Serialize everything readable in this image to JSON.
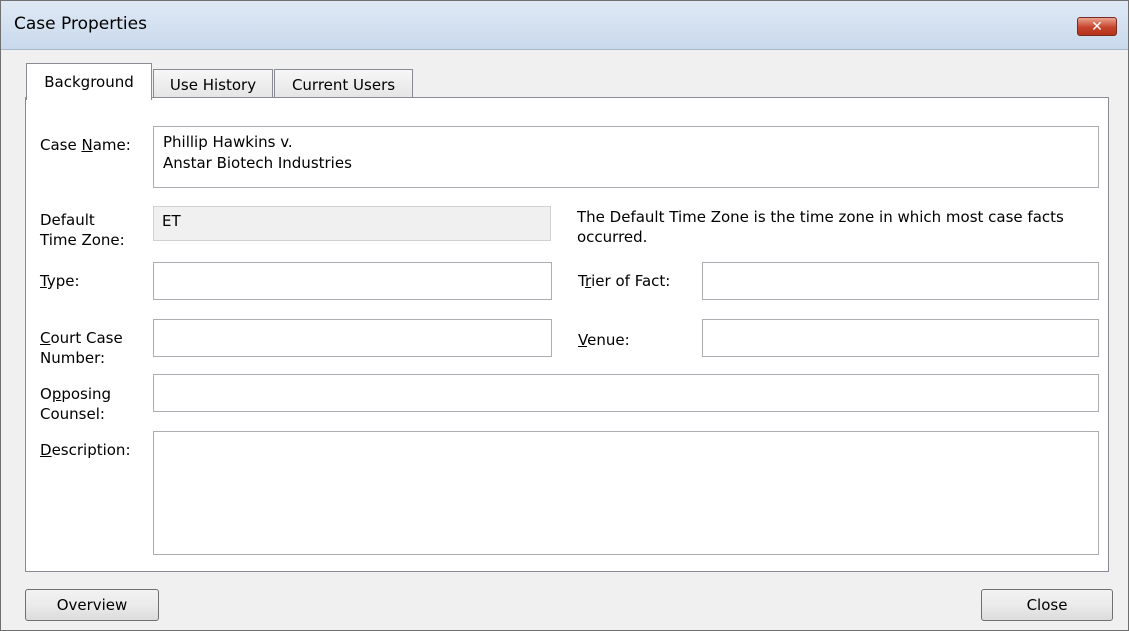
{
  "window": {
    "title": "Case Properties",
    "close_glyph": "✕"
  },
  "tabs": [
    "Background",
    "Use History",
    "Current Users"
  ],
  "form": {
    "case_name": {
      "label": "Case Name:",
      "ul": "N",
      "value": "Phillip Hawkins v.\nAnstar Biotech Industries"
    },
    "time_zone": {
      "label": "Default\nTime Zone:",
      "value": "ET",
      "note": "The Default Time Zone is the time zone in which most case facts occurred."
    },
    "type": {
      "label": "Type:",
      "value": ""
    },
    "trier": {
      "label": "Trier of Fact:",
      "value": ""
    },
    "court_case": {
      "label": "Court Case\nNumber:",
      "value": ""
    },
    "venue": {
      "label": "Venue:",
      "value": ""
    },
    "opposing": {
      "label": "Opposing\nCounsel:",
      "value": ""
    },
    "description": {
      "label": "Description:",
      "value": ""
    }
  },
  "buttons": {
    "overview": "Overview",
    "close": "Close"
  }
}
